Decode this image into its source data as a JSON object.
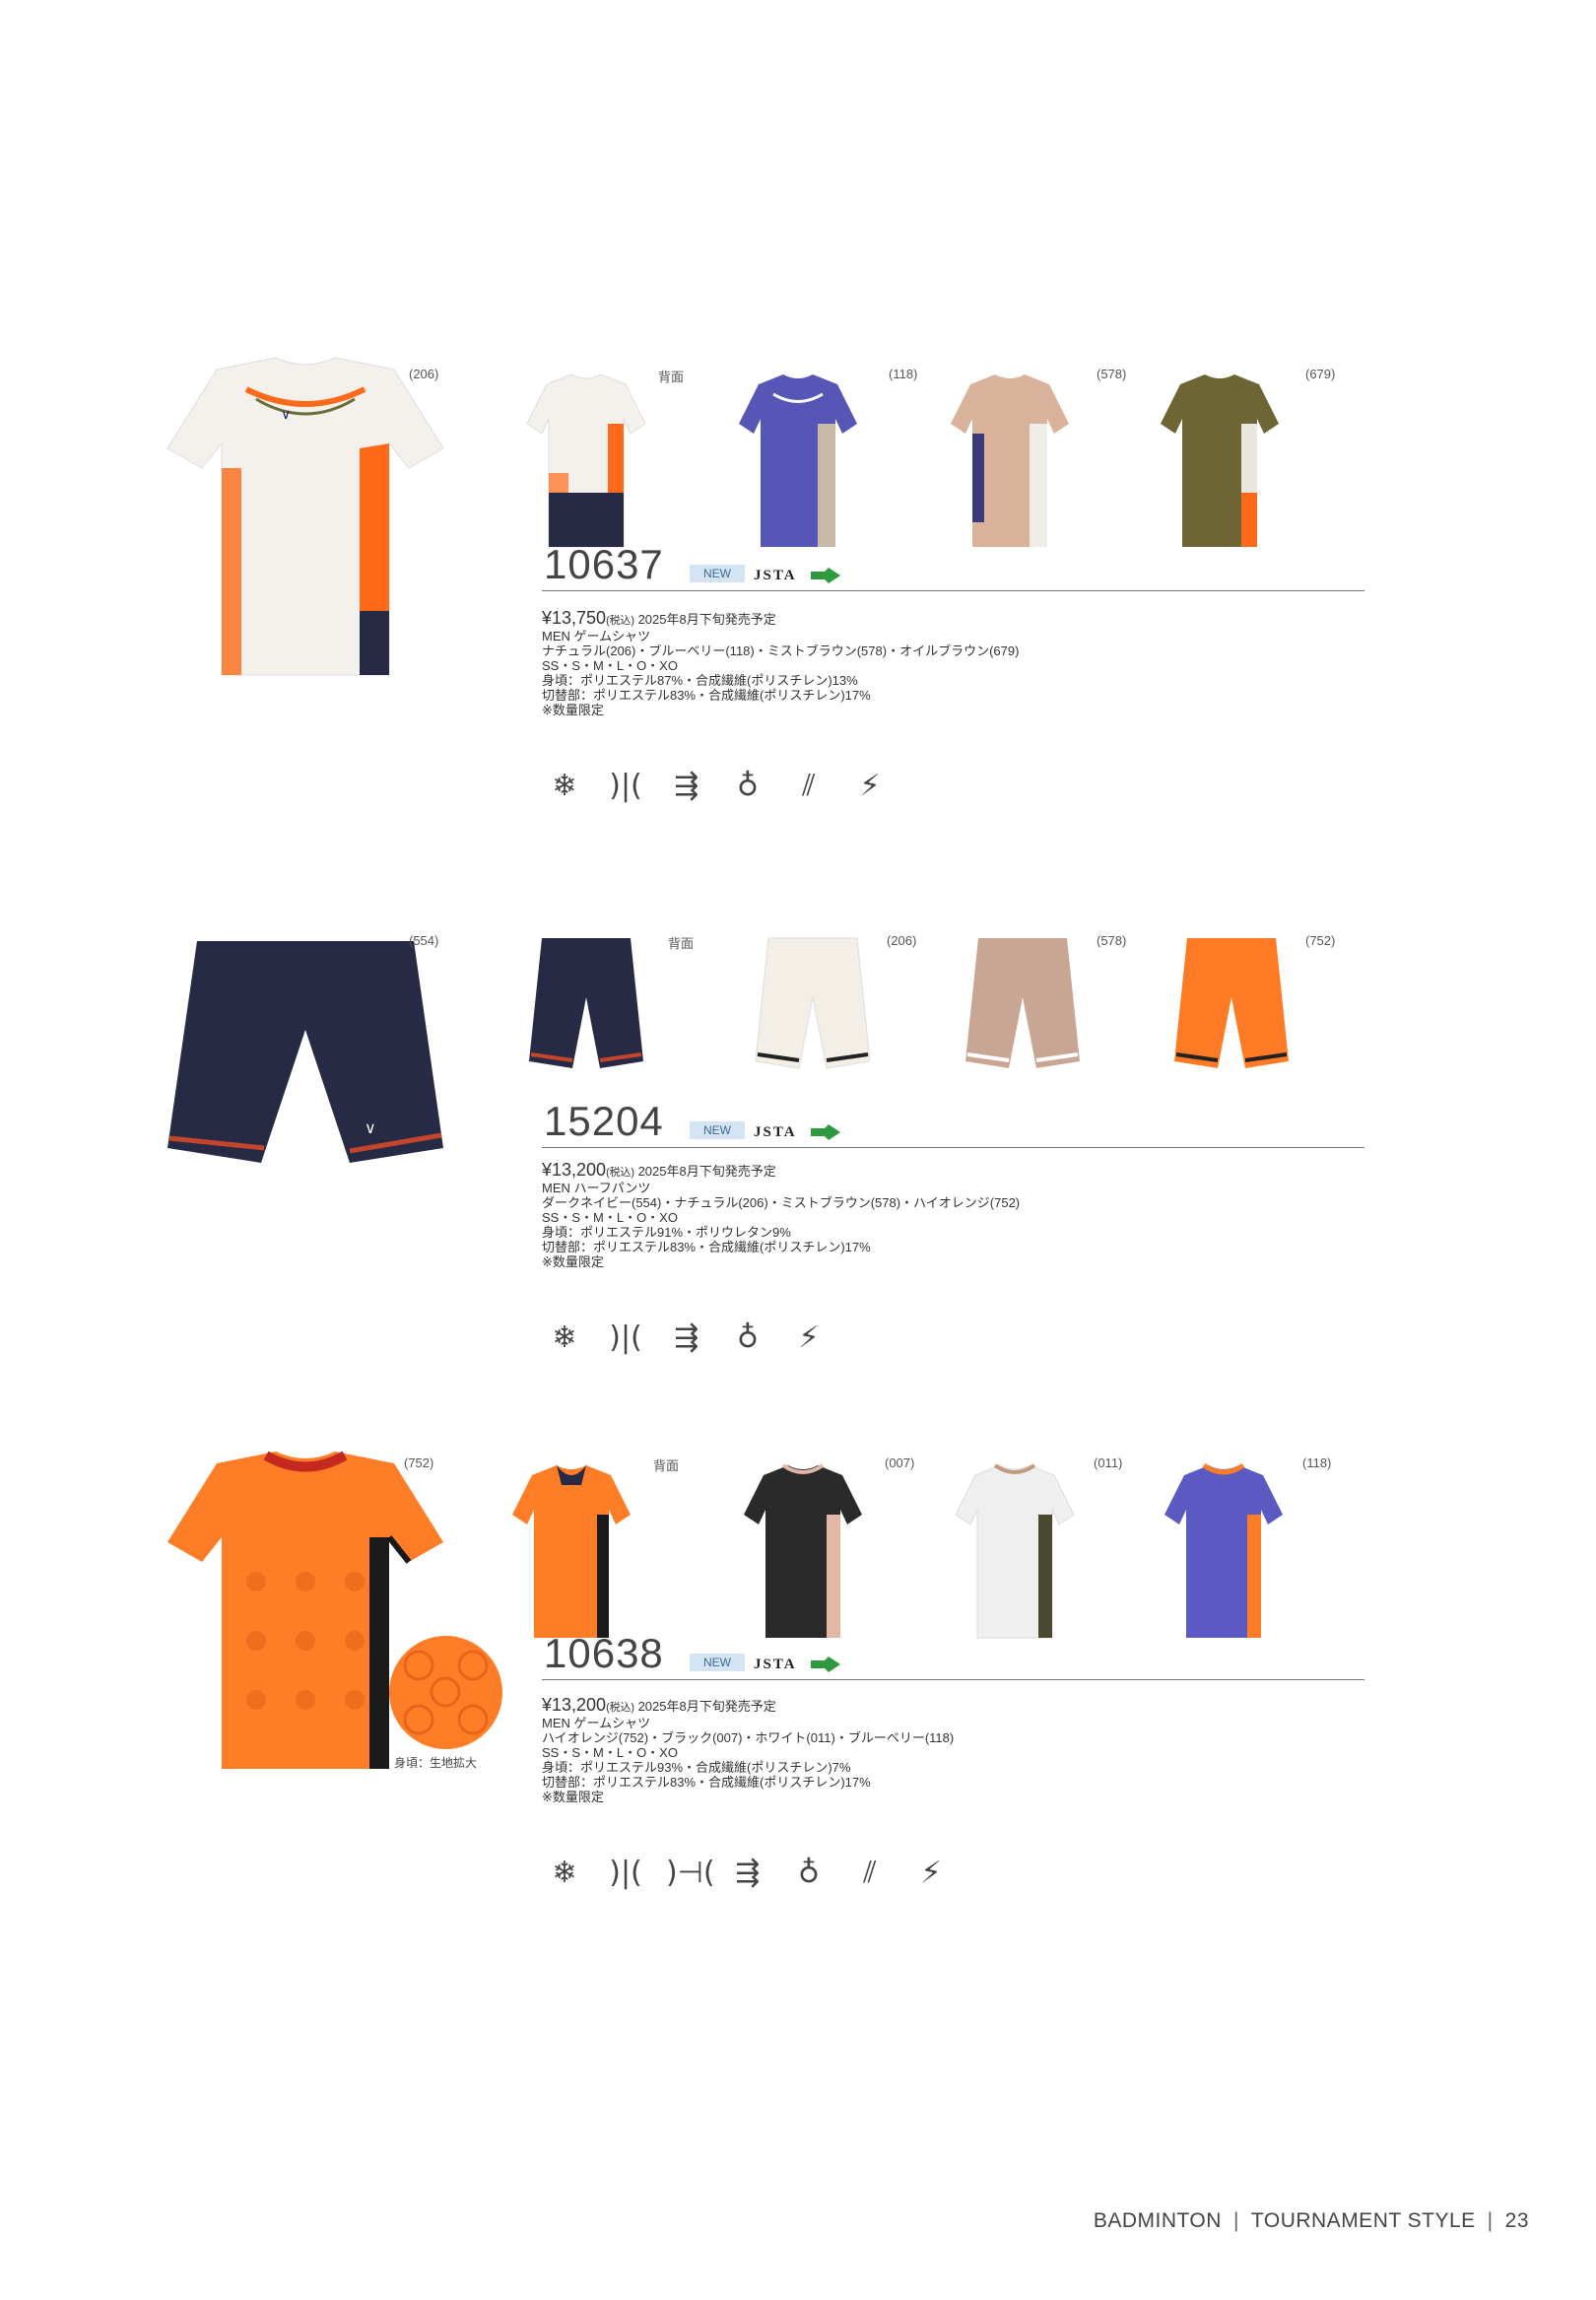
{
  "products": [
    {
      "model": "10637",
      "badge": "NEW",
      "cert": "JSTA",
      "main_code": "(206)",
      "back_label": "背面",
      "thumb_codes": [
        "(118)",
        "(578)",
        "(679)"
      ],
      "price": "¥13,750",
      "tax": "(税込)",
      "release": "2025年8月下旬発売予定",
      "category": "MEN ゲームシャツ",
      "colors": "ナチュラル(206)・ブルーベリー(118)・ミストブラウン(578)・オイルブラウン(679)",
      "sizes": "SS・S・M・L・O・XO",
      "material_body": "身頃：ポリエステル87%・合成繊維(ポリスチレン)13%",
      "material_panel": "切替部：ポリエステル83%・合成繊維(ポリスチレン)17%",
      "note": "※数量限定",
      "icons": [
        "snowflake-icon",
        "breathable-icon",
        "stretch-icon",
        "sweat-icon",
        "uv-cut-icon",
        "antistatic-icon"
      ]
    },
    {
      "model": "15204",
      "badge": "NEW",
      "cert": "JSTA",
      "main_code": "(554)",
      "back_label": "背面",
      "thumb_codes": [
        "(206)",
        "(578)",
        "(752)"
      ],
      "price": "¥13,200",
      "tax": "(税込)",
      "release": "2025年8月下旬発売予定",
      "category": "MEN ハーフパンツ",
      "colors": "ダークネイビー(554)・ナチュラル(206)・ミストブラウン(578)・ハイオレンジ(752)",
      "sizes": "SS・S・M・L・O・XO",
      "material_body": "身頃：ポリエステル91%・ポリウレタン9%",
      "material_panel": "切替部：ポリエステル83%・合成繊維(ポリスチレン)17%",
      "note": "※数量限定",
      "icons": [
        "snowflake-icon",
        "breathable-icon",
        "stretch-icon",
        "sweat-icon",
        "antistatic-icon"
      ]
    },
    {
      "model": "10638",
      "badge": "NEW",
      "cert": "JSTA",
      "main_code": "(752)",
      "back_label": "背面",
      "thumb_codes": [
        "(007)",
        "(011)",
        "(118)"
      ],
      "swatch_caption": "身頃：生地拡大",
      "price": "¥13,200",
      "tax": "(税込)",
      "release": "2025年8月下旬発売予定",
      "category": "MEN ゲームシャツ",
      "colors": "ハイオレンジ(752)・ブラック(007)・ホワイト(011)・ブルーベリー(118)",
      "sizes": "SS・S・M・L・O・XO",
      "material_body": "身頃：ポリエステル93%・合成繊維(ポリスチレン)7%",
      "material_panel": "切替部：ポリエステル83%・合成繊維(ポリスチレン)17%",
      "note": "※数量限定",
      "icons": [
        "snowflake-icon",
        "breathable-icon",
        "ventilation-icon",
        "stretch-icon",
        "sweat-icon",
        "uv-cut-icon",
        "antistatic-icon"
      ]
    }
  ],
  "icon_glyphs": {
    "snowflake-icon": "❄",
    "breathable-icon": ")|(",
    "ventilation-icon": ")⊣(",
    "stretch-icon": "⇶",
    "sweat-icon": "♁",
    "uv-cut-icon": "⫽",
    "antistatic-icon": "⚡"
  },
  "footer": {
    "section": "BADMINTON",
    "subsection": "TOURNAMENT STYLE",
    "page": "23"
  }
}
